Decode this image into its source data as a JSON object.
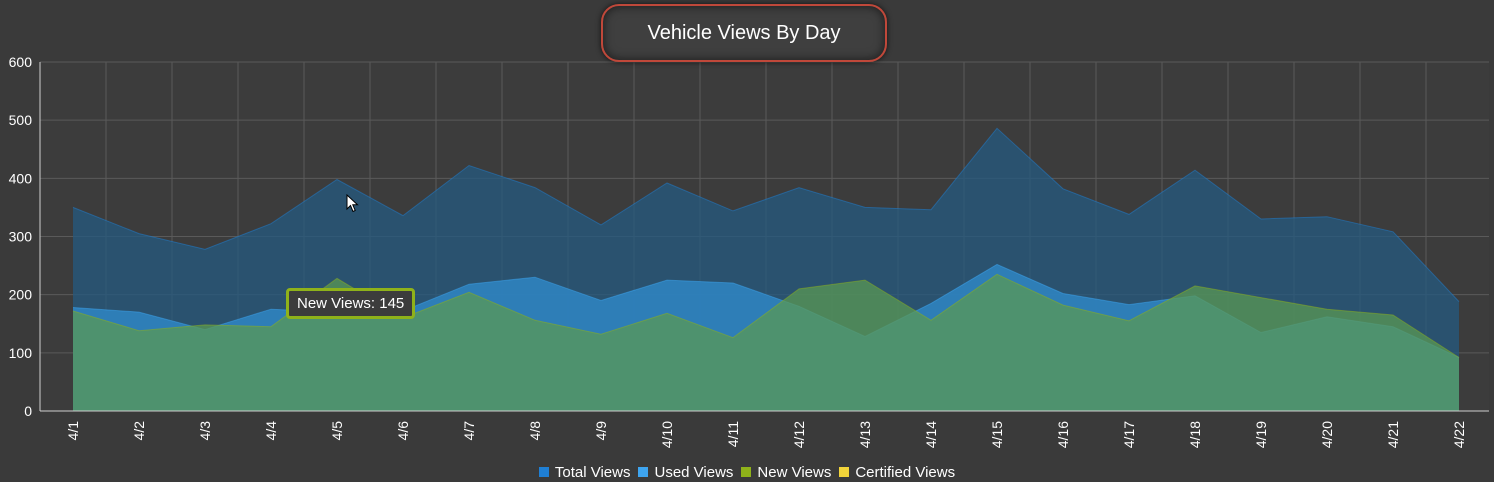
{
  "title": "Vehicle Views By Day",
  "tooltip": {
    "label": "New Views: 145"
  },
  "colors": {
    "background": "#3a3a3a",
    "grid": "#5a5a5a",
    "title_border": "#c0483a",
    "tooltip_border": "#8fb21a"
  },
  "legend": [
    {
      "label": "Total Views",
      "color": "#1f7fd4"
    },
    {
      "label": "Used Views",
      "color": "#3ea5f0"
    },
    {
      "label": "New Views",
      "color": "#8fb21a"
    },
    {
      "label": "Certified Views",
      "color": "#f2d43a"
    }
  ],
  "chart_data": {
    "type": "area",
    "categories": [
      "4/1",
      "4/2",
      "4/3",
      "4/4",
      "4/5",
      "4/6",
      "4/7",
      "4/8",
      "4/9",
      "4/10",
      "4/11",
      "4/12",
      "4/13",
      "4/14",
      "4/15",
      "4/16",
      "4/17",
      "4/18",
      "4/19",
      "4/20",
      "4/21",
      "4/22"
    ],
    "ylim": [
      0,
      600
    ],
    "yticks": [
      0,
      100,
      200,
      300,
      400,
      500,
      600
    ],
    "grid": true,
    "legend_position": "bottom",
    "series": [
      {
        "name": "Total Views",
        "color": "#1f7fd4",
        "fill": "#245a80",
        "values": [
          350,
          305,
          278,
          322,
          398,
          336,
          422,
          384,
          320,
          392,
          344,
          384,
          350,
          346,
          486,
          382,
          338,
          414,
          330,
          334,
          308,
          188
        ]
      },
      {
        "name": "Used Views",
        "color": "#3ea5f0",
        "fill": "#2f86c4",
        "values": [
          178,
          170,
          140,
          175,
          170,
          172,
          218,
          230,
          190,
          225,
          220,
          180,
          128,
          185,
          252,
          202,
          183,
          198,
          135,
          162,
          145,
          92
        ]
      },
      {
        "name": "New Views",
        "color": "#8fb21a",
        "fill": "#5c9a52",
        "values": [
          172,
          138,
          148,
          145,
          228,
          160,
          204,
          156,
          132,
          168,
          126,
          210,
          225,
          156,
          235,
          182,
          155,
          215,
          195,
          175,
          165,
          92
        ]
      },
      {
        "name": "Certified Views",
        "color": "#f2d43a",
        "fill": "#f2d43a",
        "values": [
          0,
          0,
          0,
          0,
          0,
          0,
          0,
          0,
          0,
          0,
          0,
          0,
          0,
          0,
          0,
          0,
          0,
          0,
          0,
          0,
          0,
          0
        ]
      }
    ]
  }
}
